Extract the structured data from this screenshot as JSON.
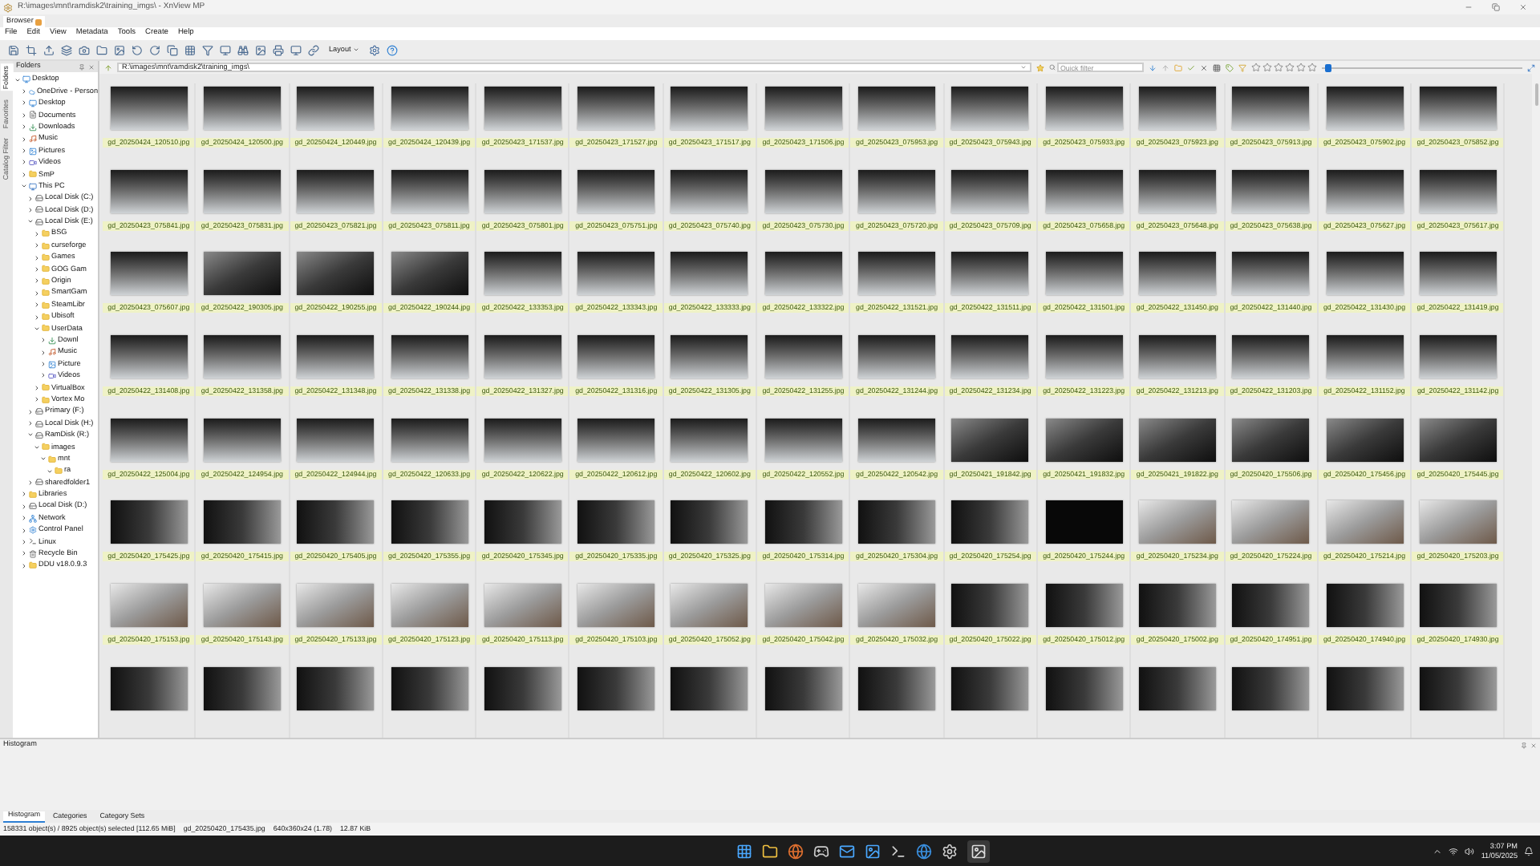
{
  "window": {
    "title": "R:\\images\\mnt\\ramdisk2\\training_imgs\\ - XnView MP"
  },
  "doc_tabs": [
    {
      "label": "Browser",
      "selected": true
    }
  ],
  "menu": [
    "File",
    "Edit",
    "View",
    "Metadata",
    "Tools",
    "Create",
    "Help"
  ],
  "toolbar": {
    "layout_button": "Layout"
  },
  "side_tabs": [
    {
      "label": "Folders",
      "selected": true
    },
    {
      "label": "Favorites",
      "selected": false
    },
    {
      "label": "Catalog Filter",
      "selected": false
    }
  ],
  "folders_panel": {
    "title": "Folders",
    "tree": [
      {
        "label": "Desktop",
        "kind": "desktop",
        "expanded": true,
        "children": [
          {
            "label": "OneDrive - Person",
            "kind": "cloud",
            "expanded": false
          },
          {
            "label": "Desktop",
            "kind": "desktop",
            "expanded": false
          },
          {
            "label": "Documents",
            "kind": "doc",
            "expanded": false
          },
          {
            "label": "Downloads",
            "kind": "download",
            "expanded": false
          },
          {
            "label": "Music",
            "kind": "music",
            "expanded": false
          },
          {
            "label": "Pictures",
            "kind": "picture",
            "expanded": false
          },
          {
            "label": "Videos",
            "kind": "video",
            "expanded": false
          },
          {
            "label": "SmP",
            "kind": "folder",
            "expanded": false
          },
          {
            "label": "This PC",
            "kind": "pc",
            "expanded": true,
            "children": [
              {
                "label": "Local Disk (C:)",
                "kind": "drive",
                "expanded": false
              },
              {
                "label": "Local Disk (D:)",
                "kind": "drive",
                "expanded": false
              },
              {
                "label": "Local Disk (E:)",
                "kind": "drive",
                "expanded": true,
                "children": [
                  {
                    "label": "BSG",
                    "kind": "folder",
                    "expanded": false
                  },
                  {
                    "label": "curseforge",
                    "kind": "folder",
                    "expanded": false
                  },
                  {
                    "label": "Games",
                    "kind": "folder",
                    "expanded": false
                  },
                  {
                    "label": "GOG Gam",
                    "kind": "folder",
                    "expanded": false
                  },
                  {
                    "label": "Origin",
                    "kind": "folder",
                    "expanded": false
                  },
                  {
                    "label": "SmartGam",
                    "kind": "folder",
                    "expanded": false
                  },
                  {
                    "label": "SteamLibr",
                    "kind": "folder",
                    "expanded": false
                  },
                  {
                    "label": "Ubisoft",
                    "kind": "folder",
                    "expanded": false
                  },
                  {
                    "label": "UserData",
                    "kind": "folder",
                    "expanded": true,
                    "children": [
                      {
                        "label": "Downl",
                        "kind": "download",
                        "expanded": false
                      },
                      {
                        "label": "Music",
                        "kind": "music",
                        "expanded": false
                      },
                      {
                        "label": "Picture",
                        "kind": "picture",
                        "expanded": false
                      },
                      {
                        "label": "Videos",
                        "kind": "video",
                        "expanded": false
                      }
                    ]
                  },
                  {
                    "label": "VirtualBox",
                    "kind": "folder",
                    "expanded": false
                  },
                  {
                    "label": "Vortex Mo",
                    "kind": "folder",
                    "expanded": false
                  }
                ]
              },
              {
                "label": "Primary (F:)",
                "kind": "drive",
                "expanded": false
              },
              {
                "label": "Local Disk (H:)",
                "kind": "drive",
                "expanded": false
              },
              {
                "label": "RamDisk (R:)",
                "kind": "drive",
                "expanded": true,
                "children": [
                  {
                    "label": "images",
                    "kind": "folder",
                    "expanded": true,
                    "children": [
                      {
                        "label": "mnt",
                        "kind": "folder",
                        "expanded": true,
                        "children": [
                          {
                            "label": "ra",
                            "kind": "folder",
                            "expanded": true
                          }
                        ]
                      }
                    ]
                  }
                ]
              },
              {
                "label": "sharedfolder1",
                "kind": "drive",
                "expanded": false
              }
            ]
          },
          {
            "label": "Libraries",
            "kind": "folder",
            "expanded": false
          },
          {
            "label": "Local Disk (D:)",
            "kind": "drive",
            "expanded": false
          },
          {
            "label": "Network",
            "kind": "network",
            "expanded": false
          },
          {
            "label": "Control Panel",
            "kind": "control",
            "expanded": false
          },
          {
            "label": "Linux",
            "kind": "linux",
            "expanded": false
          },
          {
            "label": "Recycle Bin",
            "kind": "bin",
            "expanded": false
          },
          {
            "label": "DDU v18.0.9.3",
            "kind": "folder",
            "expanded": false
          }
        ]
      }
    ]
  },
  "address_bar": {
    "value": "R:\\images\\mnt\\ramdisk2\\training_imgs\\",
    "quick_filter_placeholder": "Quick filter",
    "stars": 0,
    "thumb_size": {
      "level": 0.03
    }
  },
  "grid": {
    "rows": [
      [
        {
          "label": "gd_20250424_120510.jpg",
          "kind": "day"
        },
        {
          "label": "gd_20250424_120500.jpg",
          "kind": "day"
        },
        {
          "label": "gd_20250424_120449.jpg",
          "kind": "day"
        },
        {
          "label": "gd_20250424_120439.jpg",
          "kind": "day"
        },
        {
          "label": "gd_20250423_171537.jpg",
          "kind": "day"
        },
        {
          "label": "gd_20250423_171527.jpg",
          "kind": "day"
        },
        {
          "label": "gd_20250423_171517.jpg",
          "kind": "day"
        },
        {
          "label": "gd_20250423_171506.jpg",
          "kind": "day"
        },
        {
          "label": "gd_20250423_075953.jpg",
          "kind": "day"
        },
        {
          "label": "gd_20250423_075943.jpg",
          "kind": "day"
        },
        {
          "label": "gd_20250423_075933.jpg",
          "kind": "day"
        },
        {
          "label": "gd_20250423_075923.jpg",
          "kind": "day"
        },
        {
          "label": "gd_20250423_075913.jpg",
          "kind": "day"
        },
        {
          "label": "gd_20250423_075902.jpg",
          "kind": "day"
        },
        {
          "label": "gd_20250423_075852.jpg",
          "kind": "day"
        }
      ],
      [
        {
          "label": "gd_20250423_075841.jpg",
          "kind": "day"
        },
        {
          "label": "gd_20250423_075831.jpg",
          "kind": "day"
        },
        {
          "label": "gd_20250423_075821.jpg",
          "kind": "day"
        },
        {
          "label": "gd_20250423_075811.jpg",
          "kind": "day"
        },
        {
          "label": "gd_20250423_075801.jpg",
          "kind": "day"
        },
        {
          "label": "gd_20250423_075751.jpg",
          "kind": "day"
        },
        {
          "label": "gd_20250423_075740.jpg",
          "kind": "day"
        },
        {
          "label": "gd_20250423_075730.jpg",
          "kind": "day"
        },
        {
          "label": "gd_20250423_075720.jpg",
          "kind": "day"
        },
        {
          "label": "gd_20250423_075709.jpg",
          "kind": "day"
        },
        {
          "label": "gd_20250423_075658.jpg",
          "kind": "day"
        },
        {
          "label": "gd_20250423_075648.jpg",
          "kind": "day"
        },
        {
          "label": "gd_20250423_075638.jpg",
          "kind": "day"
        },
        {
          "label": "gd_20250423_075627.jpg",
          "kind": "day"
        },
        {
          "label": "gd_20250423_075617.jpg",
          "kind": "day"
        }
      ],
      [
        {
          "label": "gd_20250423_075607.jpg",
          "kind": "day"
        },
        {
          "label": "gd_20250422_190305.jpg",
          "kind": "night"
        },
        {
          "label": "gd_20250422_190255.jpg",
          "kind": "night"
        },
        {
          "label": "gd_20250422_190244.jpg",
          "kind": "night"
        },
        {
          "label": "gd_20250422_133353.jpg",
          "kind": "day"
        },
        {
          "label": "gd_20250422_133343.jpg",
          "kind": "day"
        },
        {
          "label": "gd_20250422_133333.jpg",
          "kind": "day"
        },
        {
          "label": "gd_20250422_133322.jpg",
          "kind": "day"
        },
        {
          "label": "gd_20250422_131521.jpg",
          "kind": "day"
        },
        {
          "label": "gd_20250422_131511.jpg",
          "kind": "day"
        },
        {
          "label": "gd_20250422_131501.jpg",
          "kind": "day"
        },
        {
          "label": "gd_20250422_131450.jpg",
          "kind": "day"
        },
        {
          "label": "gd_20250422_131440.jpg",
          "kind": "day"
        },
        {
          "label": "gd_20250422_131430.jpg",
          "kind": "day"
        },
        {
          "label": "gd_20250422_131419.jpg",
          "kind": "day"
        }
      ],
      [
        {
          "label": "gd_20250422_131408.jpg",
          "kind": "day"
        },
        {
          "label": "gd_20250422_131358.jpg",
          "kind": "day"
        },
        {
          "label": "gd_20250422_131348.jpg",
          "kind": "day"
        },
        {
          "label": "gd_20250422_131338.jpg",
          "kind": "day"
        },
        {
          "label": "gd_20250422_131327.jpg",
          "kind": "day"
        },
        {
          "label": "gd_20250422_131316.jpg",
          "kind": "day"
        },
        {
          "label": "gd_20250422_131305.jpg",
          "kind": "day"
        },
        {
          "label": "gd_20250422_131255.jpg",
          "kind": "day"
        },
        {
          "label": "gd_20250422_131244.jpg",
          "kind": "day"
        },
        {
          "label": "gd_20250422_131234.jpg",
          "kind": "day"
        },
        {
          "label": "gd_20250422_131223.jpg",
          "kind": "day"
        },
        {
          "label": "gd_20250422_131213.jpg",
          "kind": "day"
        },
        {
          "label": "gd_20250422_131203.jpg",
          "kind": "day"
        },
        {
          "label": "gd_20250422_131152.jpg",
          "kind": "day"
        },
        {
          "label": "gd_20250422_131142.jpg",
          "kind": "day"
        }
      ],
      [
        {
          "label": "gd_20250422_125004.jpg",
          "kind": "day"
        },
        {
          "label": "gd_20250422_124954.jpg",
          "kind": "day"
        },
        {
          "label": "gd_20250422_124944.jpg",
          "kind": "day"
        },
        {
          "label": "gd_20250422_120633.jpg",
          "kind": "day"
        },
        {
          "label": "gd_20250422_120622.jpg",
          "kind": "day"
        },
        {
          "label": "gd_20250422_120612.jpg",
          "kind": "day"
        },
        {
          "label": "gd_20250422_120602.jpg",
          "kind": "day"
        },
        {
          "label": "gd_20250422_120552.jpg",
          "kind": "day"
        },
        {
          "label": "gd_20250422_120542.jpg",
          "kind": "day"
        },
        {
          "label": "gd_20250421_191842.jpg",
          "kind": "night"
        },
        {
          "label": "gd_20250421_191832.jpg",
          "kind": "night"
        },
        {
          "label": "gd_20250421_191822.jpg",
          "kind": "night"
        },
        {
          "label": "gd_20250420_175506.jpg",
          "kind": "night"
        },
        {
          "label": "gd_20250420_175456.jpg",
          "kind": "night"
        },
        {
          "label": "gd_20250420_175445.jpg",
          "kind": "night"
        }
      ],
      [
        {
          "label": "gd_20250420_175425.jpg",
          "kind": "dark"
        },
        {
          "label": "gd_20250420_175415.jpg",
          "kind": "dark"
        },
        {
          "label": "gd_20250420_175405.jpg",
          "kind": "dark"
        },
        {
          "label": "gd_20250420_175355.jpg",
          "kind": "dark"
        },
        {
          "label": "gd_20250420_175345.jpg",
          "kind": "dark"
        },
        {
          "label": "gd_20250420_175335.jpg",
          "kind": "dark"
        },
        {
          "label": "gd_20250420_175325.jpg",
          "kind": "dark"
        },
        {
          "label": "gd_20250420_175314.jpg",
          "kind": "dark"
        },
        {
          "label": "gd_20250420_175304.jpg",
          "kind": "dark"
        },
        {
          "label": "gd_20250420_175254.jpg",
          "kind": "dark"
        },
        {
          "label": "gd_20250420_175244.jpg",
          "kind": "black"
        },
        {
          "label": "gd_20250420_175234.jpg",
          "kind": "light"
        },
        {
          "label": "gd_20250420_175224.jpg",
          "kind": "light"
        },
        {
          "label": "gd_20250420_175214.jpg",
          "kind": "light"
        },
        {
          "label": "gd_20250420_175203.jpg",
          "kind": "light"
        }
      ],
      [
        {
          "label": "gd_20250420_175153.jpg",
          "kind": "light"
        },
        {
          "label": "gd_20250420_175143.jpg",
          "kind": "light"
        },
        {
          "label": "gd_20250420_175133.jpg",
          "kind": "light"
        },
        {
          "label": "gd_20250420_175123.jpg",
          "kind": "light"
        },
        {
          "label": "gd_20250420_175113.jpg",
          "kind": "light"
        },
        {
          "label": "gd_20250420_175103.jpg",
          "kind": "light"
        },
        {
          "label": "gd_20250420_175052.jpg",
          "kind": "light"
        },
        {
          "label": "gd_20250420_175042.jpg",
          "kind": "light"
        },
        {
          "label": "gd_20250420_175032.jpg",
          "kind": "light"
        },
        {
          "label": "gd_20250420_175022.jpg",
          "kind": "dark"
        },
        {
          "label": "gd_20250420_175012.jpg",
          "kind": "dark"
        },
        {
          "label": "gd_20250420_175002.jpg",
          "kind": "dark"
        },
        {
          "label": "gd_20250420_174951.jpg",
          "kind": "dark"
        },
        {
          "label": "gd_20250420_174940.jpg",
          "kind": "dark"
        },
        {
          "label": "gd_20250420_174930.jpg",
          "kind": "dark"
        }
      ],
      [
        {
          "kind": "dark"
        },
        {
          "kind": "dark"
        },
        {
          "kind": "dark"
        },
        {
          "kind": "dark"
        },
        {
          "kind": "dark"
        },
        {
          "kind": "dark"
        },
        {
          "kind": "dark"
        },
        {
          "kind": "dark"
        },
        {
          "kind": "dark"
        },
        {
          "kind": "dark"
        },
        {
          "kind": "dark"
        },
        {
          "kind": "dark"
        },
        {
          "kind": "dark"
        },
        {
          "kind": "dark"
        },
        {
          "kind": "dark"
        }
      ]
    ]
  },
  "histogram_panel": {
    "title": "Histogram"
  },
  "bottom_tabs": [
    {
      "label": "Histogram",
      "selected": true
    },
    {
      "label": "Categories",
      "selected": false
    },
    {
      "label": "Category Sets",
      "selected": false
    }
  ],
  "status_bar": {
    "selection": "158331 object(s) / 8925 object(s) selected [112.65 MiB]",
    "file": "gd_20250420_175435.jpg",
    "dimensions": "640x360x24 (1.78)",
    "size": "12.87 KiB"
  },
  "taskbar": {
    "time": "3:07 PM",
    "date": "11/05/2025"
  }
}
